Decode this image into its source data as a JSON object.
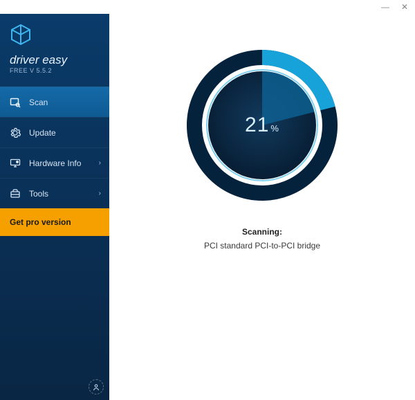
{
  "app": {
    "name": "driver easy",
    "version_line": "FREE V 5.5.2"
  },
  "colors": {
    "sidebar_top": "#0a3b6a",
    "sidebar_bottom": "#092644",
    "active_nav": "#146aa8",
    "cta_bg": "#f6a000",
    "gauge_outer": "#051b30",
    "gauge_ring": "#0e5e92",
    "gauge_highlight": "#1aa7dd",
    "gauge_inner": "#0a2843"
  },
  "nav": {
    "items": [
      {
        "label": "Scan",
        "has_submenu": false,
        "active": true
      },
      {
        "label": "Update",
        "has_submenu": false,
        "active": false
      },
      {
        "label": "Hardware Info",
        "has_submenu": true,
        "active": false
      },
      {
        "label": "Tools",
        "has_submenu": true,
        "active": false
      }
    ],
    "cta_label": "Get pro version"
  },
  "scan": {
    "progress_percent": 21,
    "progress_unit": "%",
    "status_label": "Scanning:",
    "current_item": "PCI standard PCI-to-PCI bridge"
  },
  "window": {
    "minimize_glyph": "—",
    "close_glyph": "✕"
  }
}
